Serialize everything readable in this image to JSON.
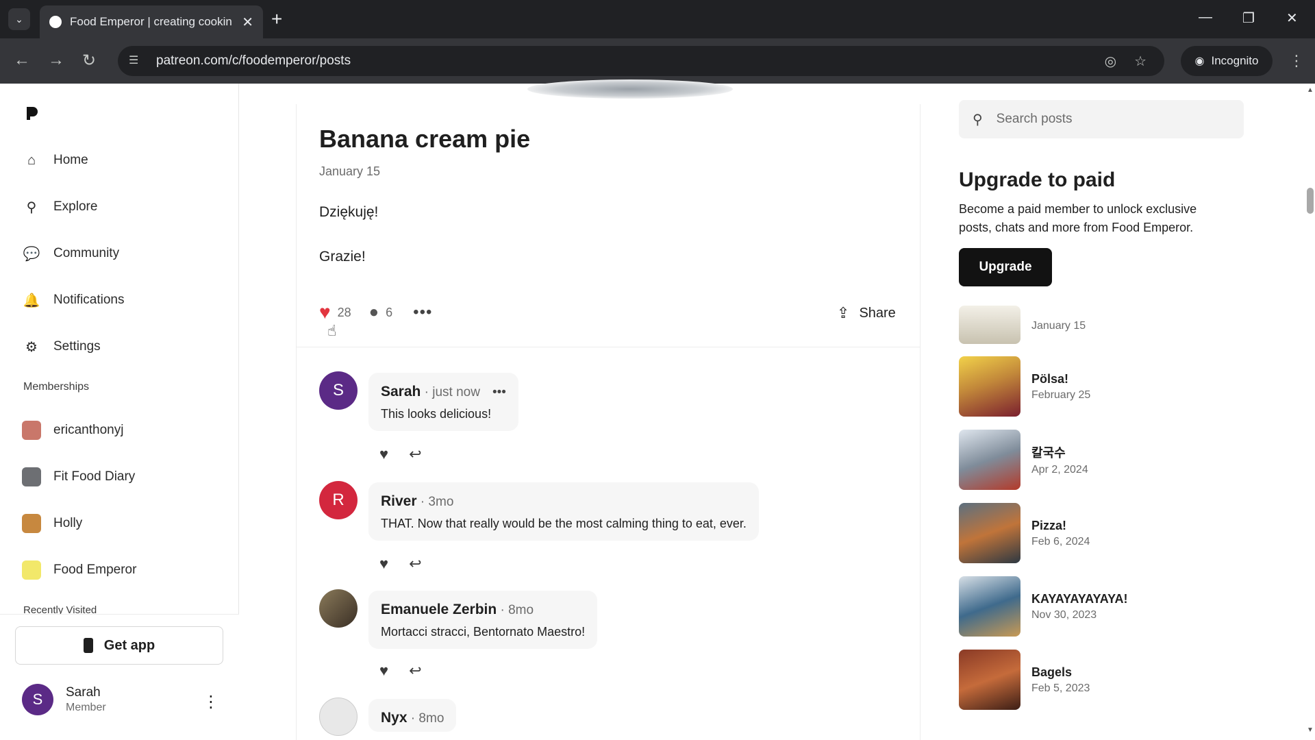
{
  "browser": {
    "tab_title": "Food Emperor | creating cookin",
    "url": "patreon.com/c/foodemperor/posts",
    "incognito_label": "Incognito"
  },
  "sidebar": {
    "nav": [
      {
        "label": "Home",
        "icon": "home-icon"
      },
      {
        "label": "Explore",
        "icon": "search-icon"
      },
      {
        "label": "Community",
        "icon": "chat-icon"
      },
      {
        "label": "Notifications",
        "icon": "bell-icon"
      },
      {
        "label": "Settings",
        "icon": "gear-icon"
      }
    ],
    "memberships_label": "Memberships",
    "memberships": [
      {
        "label": "ericanthonyj"
      },
      {
        "label": "Fit Food Diary"
      },
      {
        "label": "Holly"
      },
      {
        "label": "Food Emperor"
      }
    ],
    "recently_visited_label": "Recently Visited",
    "get_app_label": "Get app",
    "profile": {
      "initial": "S",
      "name": "Sarah",
      "role": "Member"
    }
  },
  "post": {
    "title": "Banana cream pie",
    "date": "January 15",
    "body": [
      "Dziękuję!",
      "Grazie!"
    ],
    "likes": "28",
    "comments_count": "6",
    "share_label": "Share"
  },
  "comments": [
    {
      "initial": "S",
      "author": "Sarah",
      "time": "just now",
      "text": "This looks delicious!",
      "color": "#5b2a86"
    },
    {
      "initial": "R",
      "author": "River",
      "time": "3mo",
      "text": "THAT. Now that really would be the most calming thing to eat, ever.",
      "color": "#d3273e"
    },
    {
      "initial": "",
      "author": "Emanuele Zerbin",
      "time": "8mo",
      "text": "Mortacci stracci, Bentornato Maestro!",
      "color": "#5a4a3a"
    },
    {
      "initial": "",
      "author": "Nyx",
      "time": "8mo",
      "text": "",
      "color": "#e8e8e8"
    }
  ],
  "right": {
    "search_placeholder": "Search posts",
    "upgrade_title": "Upgrade to paid",
    "upgrade_desc": "Become a paid member to unlock exclusive posts, chats and more from Food Emperor.",
    "upgrade_button": "Upgrade",
    "related": [
      {
        "title": "",
        "date": "January 15"
      },
      {
        "title": "Pölsa!",
        "date": "February 25"
      },
      {
        "title": "칼국수",
        "date": "Apr 2, 2024"
      },
      {
        "title": "Pizza!",
        "date": "Feb 6, 2024"
      },
      {
        "title": "KAYAYAYAYAYA!",
        "date": "Nov 30, 2023"
      },
      {
        "title": "Bagels",
        "date": "Feb 5, 2023"
      }
    ]
  },
  "colors": {
    "heart": "#e2353f",
    "button_dark": "#121212"
  }
}
